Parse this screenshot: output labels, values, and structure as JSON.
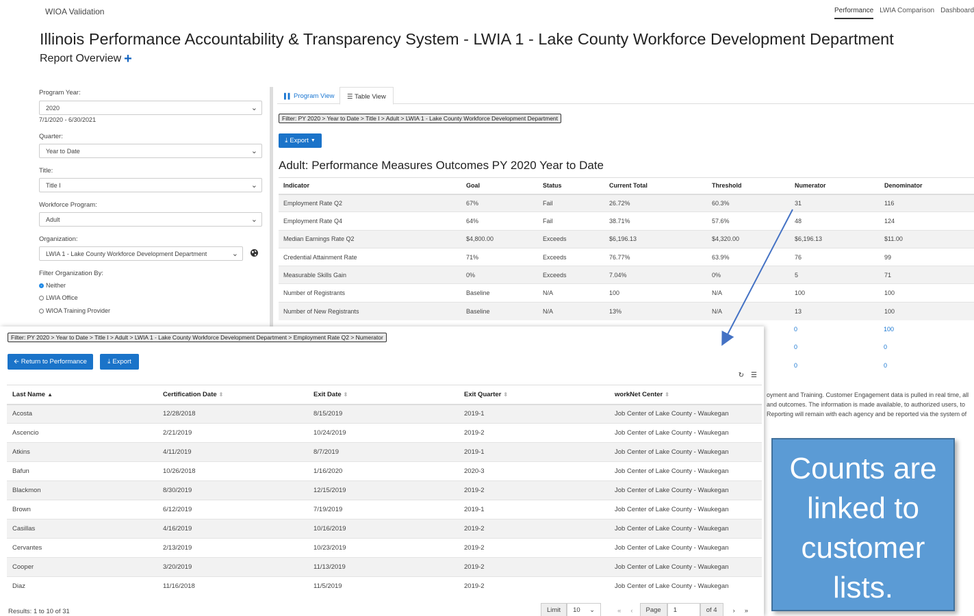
{
  "app": {
    "brand": "WIOA Validation"
  },
  "topnav": [
    "Performance",
    "LWIA Comparison",
    "Dashboard"
  ],
  "page": {
    "title": "Illinois Performance Accountability & Transparency System - LWIA 1 - Lake County Workforce Development Department",
    "subtitle": "Report Overview"
  },
  "filters": {
    "program_year_label": "Program Year:",
    "program_year": "2020",
    "program_year_range": "7/1/2020 - 6/30/2021",
    "quarter_label": "Quarter:",
    "quarter": "Year to Date",
    "title_label": "Title:",
    "title": "Title I",
    "workforce_program_label": "Workforce Program:",
    "workforce_program": "Adult",
    "organization_label": "Organization:",
    "organization": "LWIA 1 - Lake County Workforce Development Department",
    "filter_by_label": "Filter Organization By:",
    "filter_by_options": [
      "Neither",
      "LWIA Office",
      "WIOA Training Provider"
    ],
    "filter_by_selected": "Neither"
  },
  "tabs": [
    "Program View",
    "Table View"
  ],
  "main": {
    "filter_path": "Filter: PY 2020 > Year to Date > Title I > Adult > LWIA 1 - Lake County Workforce Development Department",
    "export_label": "Export",
    "heading": "Adult: Performance Measures Outcomes PY 2020 Year to Date",
    "columns": [
      "Indicator",
      "Goal",
      "Status",
      "Current Total",
      "Threshold",
      "Numerator",
      "Denominator"
    ],
    "rows": [
      [
        "Employment Rate Q2",
        "67%",
        "Fail",
        "26.72%",
        "60.3%",
        "31",
        "116"
      ],
      [
        "Employment Rate Q4",
        "64%",
        "Fail",
        "38.71%",
        "57.6%",
        "48",
        "124"
      ],
      [
        "Median Earnings Rate Q2",
        "$4,800.00",
        "Exceeds",
        "$6,196.13",
        "$4,320.00",
        "$6,196.13",
        "$11.00"
      ],
      [
        "Credential Attainment Rate",
        "71%",
        "Exceeds",
        "76.77%",
        "63.9%",
        "76",
        "99"
      ],
      [
        "Measurable Skills Gain",
        "0%",
        "Exceeds",
        "7.04%",
        "0%",
        "5",
        "71"
      ],
      [
        "Number of Registrants",
        "Baseline",
        "N/A",
        "100",
        "N/A",
        "100",
        "100"
      ],
      [
        "Number of New Registrants",
        "Baseline",
        "N/A",
        "13%",
        "N/A",
        "13",
        "100"
      ]
    ],
    "hidden_rows_tail": [
      [
        "0",
        "100"
      ],
      [
        "0",
        "0"
      ],
      [
        "0",
        "0"
      ]
    ],
    "footnote_fragments": [
      "oyment and Training. Customer Engagement data is pulled in real time, all",
      "and outcomes. The information is made available, to authorized users, to",
      "Reporting will remain with each agency and be reported via the system of"
    ]
  },
  "detail": {
    "filter_path": "Filter: PY 2020 > Year to Date > Title I > Adult > LWIA 1 - Lake County Workforce Development Department > Employment Rate Q2 > Numerator",
    "return_label": "Return to Performance",
    "export_label": "Export",
    "columns": [
      "Last Name",
      "Certification Date",
      "Exit Date",
      "Exit Quarter",
      "workNet Center"
    ],
    "rows": [
      [
        "Acosta",
        "12/28/2018",
        "8/15/2019",
        "2019-1",
        "Job Center of Lake County - Waukegan"
      ],
      [
        "Ascencio",
        "2/21/2019",
        "10/24/2019",
        "2019-2",
        "Job Center of Lake County - Waukegan"
      ],
      [
        "Atkins",
        "4/11/2019",
        "8/7/2019",
        "2019-1",
        "Job Center of Lake County - Waukegan"
      ],
      [
        "Bafun",
        "10/26/2018",
        "1/16/2020",
        "2020-3",
        "Job Center of Lake County - Waukegan"
      ],
      [
        "Blackmon",
        "8/30/2019",
        "12/15/2019",
        "2019-2",
        "Job Center of Lake County - Waukegan"
      ],
      [
        "Brown",
        "6/12/2019",
        "7/19/2019",
        "2019-1",
        "Job Center of Lake County - Waukegan"
      ],
      [
        "Casillas",
        "4/16/2019",
        "10/16/2019",
        "2019-2",
        "Job Center of Lake County - Waukegan"
      ],
      [
        "Cervantes",
        "2/13/2019",
        "10/23/2019",
        "2019-2",
        "Job Center of Lake County - Waukegan"
      ],
      [
        "Cooper",
        "3/20/2019",
        "11/13/2019",
        "2019-2",
        "Job Center of Lake County - Waukegan"
      ],
      [
        "Diaz",
        "11/16/2018",
        "11/5/2019",
        "2019-2",
        "Job Center of Lake County - Waukegan"
      ]
    ],
    "results": "Results: 1 to 10 of 31",
    "limit_label": "Limit",
    "limit_value": "10",
    "page_label": "Page",
    "page_value": "1",
    "of_pages": "of 4"
  },
  "callout": {
    "text": "Counts are linked to customer lists."
  },
  "icons": {
    "plus": "plus-icon",
    "chart": "bar-chart-icon",
    "table": "table-icon",
    "download": "download-icon",
    "globe": "globe-icon",
    "refresh": "refresh-icon",
    "list": "list-icon",
    "arrow-left": "arrow-left-icon"
  },
  "colors": {
    "accent": "#1a73c9",
    "link": "#1976d2",
    "callout": "#5b9bd5",
    "arrow": "#4472c4"
  }
}
